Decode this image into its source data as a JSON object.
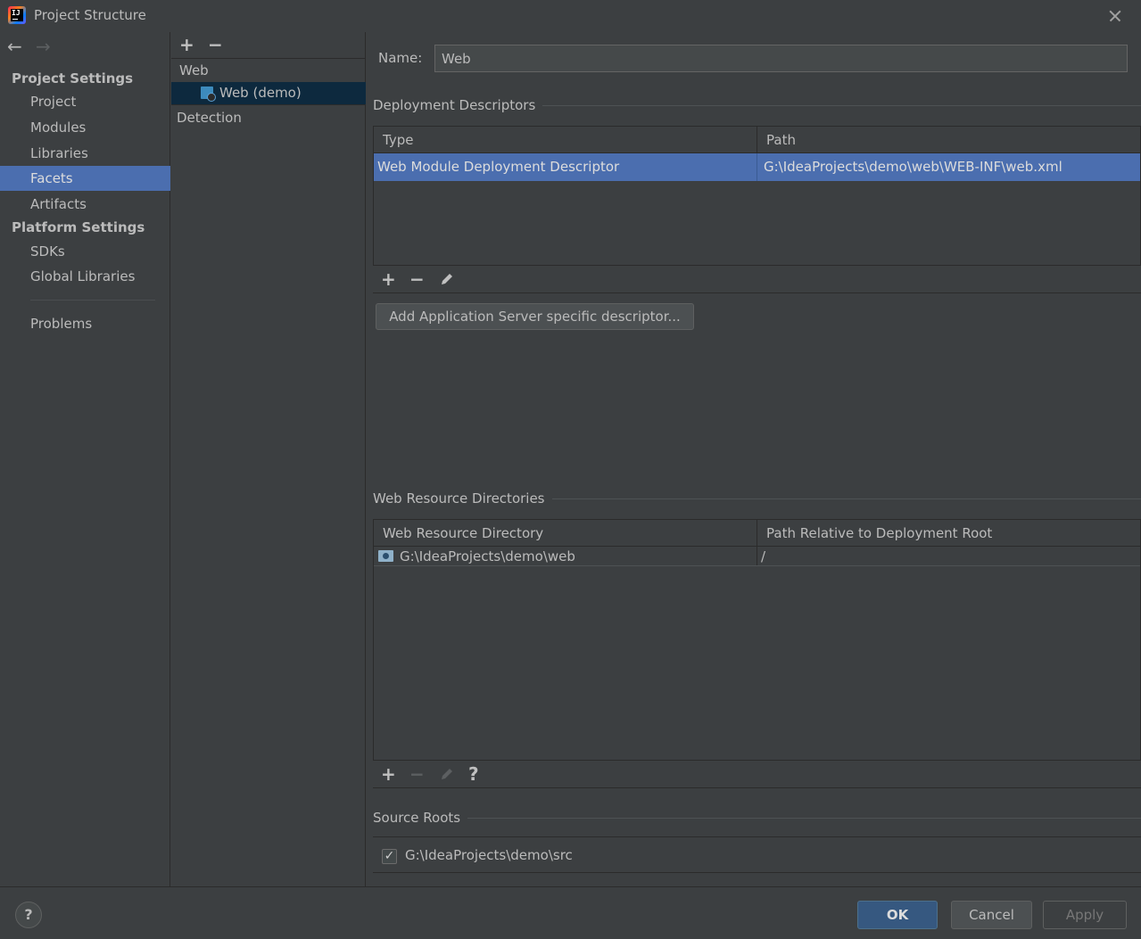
{
  "window": {
    "title": "Project Structure"
  },
  "sidebar": {
    "project_settings_header": "Project Settings",
    "project_items": [
      {
        "label": "Project"
      },
      {
        "label": "Modules"
      },
      {
        "label": "Libraries"
      },
      {
        "label": "Facets",
        "selected": true
      },
      {
        "label": "Artifacts"
      }
    ],
    "platform_settings_header": "Platform Settings",
    "platform_items": [
      {
        "label": "SDKs"
      },
      {
        "label": "Global Libraries"
      }
    ],
    "problems_label": "Problems"
  },
  "tree": {
    "add_icon": "+",
    "remove_icon": "−",
    "group_label": "Web",
    "selected_item": "Web (demo)",
    "detection_label": "Detection"
  },
  "facet": {
    "name_label": "Name:",
    "name_value": "Web",
    "deployment": {
      "title": "Deployment Descriptors",
      "columns": [
        "Type",
        "Path"
      ],
      "rows": [
        {
          "type": "Web Module Deployment Descriptor",
          "path": "G:\\IdeaProjects\\demo\\web\\WEB-INF\\web.xml",
          "selected": true
        }
      ],
      "add_server_descriptor_button": "Add Application Server specific descriptor..."
    },
    "web_resources": {
      "title": "Web Resource Directories",
      "columns": [
        "Web Resource Directory",
        "Path Relative to Deployment Root"
      ],
      "rows": [
        {
          "directory": "G:\\IdeaProjects\\demo\\web",
          "relative_path": "/"
        }
      ],
      "help_icon": "?"
    },
    "source_roots": {
      "title": "Source Roots",
      "items": [
        {
          "path": "G:\\IdeaProjects\\demo\\src",
          "checked": true
        }
      ]
    }
  },
  "footer": {
    "help_label": "?",
    "ok_label": "OK",
    "cancel_label": "Cancel",
    "apply_label": "Apply"
  },
  "colors": {
    "background": "#3c3f41",
    "selection": "#4b6eaf",
    "tree_selection": "#0d293e",
    "ok_button": "#365880"
  }
}
